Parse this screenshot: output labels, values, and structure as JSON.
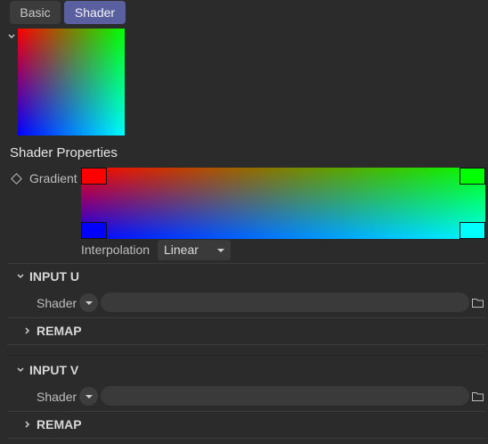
{
  "tabs": [
    {
      "label": "Basic",
      "active": false
    },
    {
      "label": "Shader",
      "active": true
    }
  ],
  "section_title": "Shader Properties",
  "gradient": {
    "label": "Gradient",
    "colors": {
      "top_left": "#ff0000",
      "top_right": "#00ff00",
      "bottom_left": "#0000ff",
      "bottom_right": "#00ffff"
    }
  },
  "interpolation": {
    "label": "Interpolation",
    "value": "Linear"
  },
  "input_u": {
    "title": "INPUT U",
    "shader_label": "Shader",
    "shader_value": "",
    "remap_label": "REMAP"
  },
  "input_v": {
    "title": "INPUT V",
    "shader_label": "Shader",
    "shader_value": "",
    "remap_label": "REMAP"
  },
  "colors": {
    "background": "#2b2b2b",
    "active_tab": "#5a5fa0",
    "field": "#3a3a3a"
  }
}
